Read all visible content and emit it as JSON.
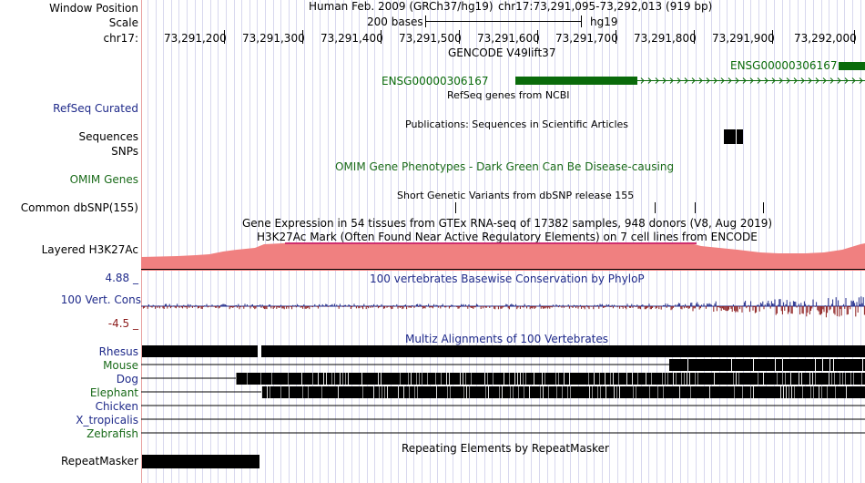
{
  "labels": {
    "window_position": "Window Position",
    "scale": "Scale",
    "chr": "chr17:",
    "refseq": "RefSeq Curated",
    "sequences": "Sequences",
    "snps": "SNPs",
    "omim": "OMIM Genes",
    "dbsnp": "Common dbSNP(155)",
    "h3k27ac": "Layered H3K27Ac",
    "cons_max": "4.88 _",
    "cons": "100 Vert. Cons",
    "cons_min": "-4.5 _",
    "repeatmasker": "RepeatMasker"
  },
  "header": {
    "assembly": "Human Feb. 2009 (GRCh37/hg19)",
    "position": "chr17:73,291,095-73,292,013 (919 bp)",
    "scale_bases": "200 bases",
    "scale_db": "hg19",
    "coords": [
      "73,291,200",
      "73,291,300",
      "73,291,400",
      "73,291,500",
      "73,291,600",
      "73,291,700",
      "73,291,800",
      "73,291,900",
      "73,292,000"
    ]
  },
  "tracks": {
    "gencode_title": "GENCODE V49lift37",
    "gene_a": "ENSG00000306167",
    "gene_b": "ENSG00000306167",
    "refseq_title": "RefSeq genes from NCBI",
    "pubs_title": "Publications: Sequences in Scientific Articles",
    "omim_title": "OMIM Gene Phenotypes - Dark Green Can Be Disease-causing",
    "dbsnp_title": "Short Genetic Variants from dbSNP release 155",
    "gtex_title": "Gene Expression in 54 tissues from GTEx RNA-seq of 17382 samples, 948 donors (V8, Aug 2019)",
    "h3k_title": "H3K27Ac Mark (Often Found Near Active Regulatory Elements) on 7 cell lines from ENCODE",
    "phylop_title": "100 vertebrates Basewise Conservation by PhyloP",
    "multiz_title": "Multiz Alignments of 100 Vertebrates",
    "repeat_title": "Repeating Elements by RepeatMasker"
  },
  "species": [
    {
      "name": "Rhesus",
      "color": "#1f2a8a"
    },
    {
      "name": "Mouse",
      "color": "#1a6b1a"
    },
    {
      "name": "Dog",
      "color": "#1f2a8a"
    },
    {
      "name": "Elephant",
      "color": "#1a6b1a"
    },
    {
      "name": "Chicken",
      "color": "#1f2a8a"
    },
    {
      "name": "X_tropicalis",
      "color": "#1f2a8a"
    },
    {
      "name": "Zebrafish",
      "color": "#1a6b1a"
    }
  ],
  "colors": {
    "gene": "#0a6b0a",
    "h3k27ac": "#f08080",
    "cons_pos": "#1f2a8a",
    "cons_neg": "#8b1a1a"
  }
}
